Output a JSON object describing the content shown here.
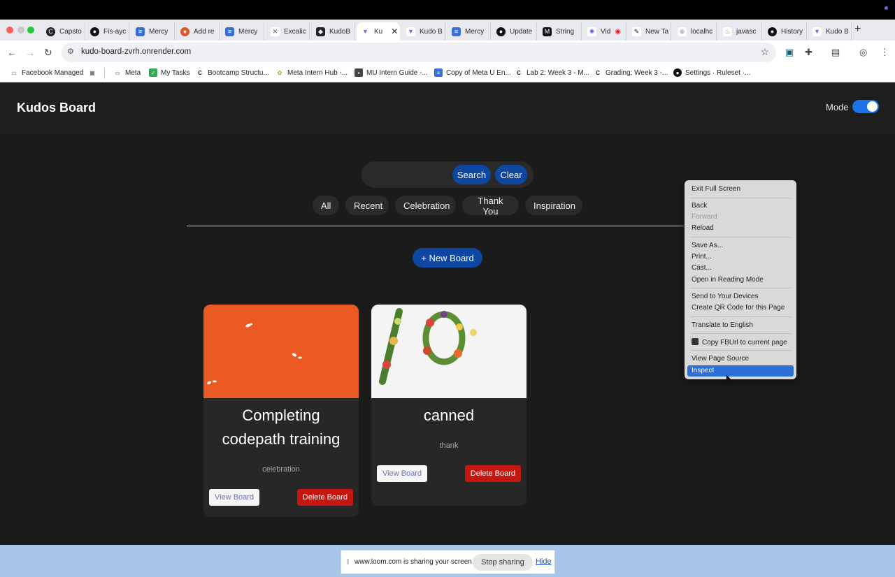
{
  "browser": {
    "tabs": [
      {
        "label": "Capsto",
        "icon": "codepath-icon"
      },
      {
        "label": "Fis-ayc",
        "icon": "github-icon"
      },
      {
        "label": "Mercy",
        "icon": "docs-icon"
      },
      {
        "label": "Add re",
        "icon": "reddit-icon"
      },
      {
        "label": "Mercy",
        "icon": "docs-icon"
      },
      {
        "label": "Excalic",
        "icon": "excalidraw-icon"
      },
      {
        "label": "KudoB",
        "icon": "app-icon"
      },
      {
        "label": "Ku",
        "icon": "vite-icon",
        "active": true
      },
      {
        "label": "Kudo B",
        "icon": "vite-icon"
      },
      {
        "label": "Mercy",
        "icon": "docs-icon"
      },
      {
        "label": "Update",
        "icon": "github-icon"
      },
      {
        "label": "String",
        "icon": "medium-icon"
      },
      {
        "label": "Vid",
        "icon": "gear-icon"
      },
      {
        "label": "New Ta",
        "icon": "figma-icon"
      },
      {
        "label": "localhc",
        "icon": "globe-icon"
      },
      {
        "label": "javasc",
        "icon": "java-icon"
      },
      {
        "label": "History",
        "icon": "github-icon"
      },
      {
        "label": "Kudo B",
        "icon": "vite-icon"
      }
    ],
    "url": "kudo-board-zvrh.onrender.com",
    "bookmarks": [
      "Facebook Managed",
      "Meta",
      "My Tasks",
      "Bootcamp Structu...",
      "Meta Intern Hub -...",
      "MU Intern Guide -...",
      "Copy of Meta U En...",
      "Lab 2: Week 3 - M...",
      "Grading: Week 3 -...",
      "Settings · Ruleset ·..."
    ]
  },
  "app": {
    "title": "Kudos Board",
    "mode_label": "Mode",
    "dark_mode_on": true,
    "search": {
      "value": "",
      "placeholder": "",
      "search_label": "Search",
      "clear_label": "Clear"
    },
    "filters": [
      "All",
      "Recent",
      "Celebration",
      "Thank You",
      "Inspiration"
    ],
    "new_board_label": "+ New Board",
    "boards": [
      {
        "title": "Completing codepath training",
        "category": "celebration",
        "view_label": "View Board",
        "delete_label": "Delete Board",
        "image": "orange-background-with-seeds"
      },
      {
        "title": "canned",
        "category": "thank",
        "view_label": "View Board",
        "delete_label": "Delete Board",
        "image": "vegetable-wreath-on-white"
      }
    ]
  },
  "context_menu": {
    "items": [
      {
        "label": "Exit Full Screen",
        "enabled": true
      },
      {
        "label": "Back",
        "enabled": true
      },
      {
        "label": "Forward",
        "enabled": false
      },
      {
        "label": "Reload",
        "enabled": true
      },
      {
        "label": "Save As...",
        "enabled": true
      },
      {
        "label": "Print...",
        "enabled": true
      },
      {
        "label": "Cast...",
        "enabled": true
      },
      {
        "label": "Open in Reading Mode",
        "enabled": true
      },
      {
        "label": "Send to Your Devices",
        "enabled": true
      },
      {
        "label": "Create QR Code for this Page",
        "enabled": true
      },
      {
        "label": "Translate to English",
        "enabled": true
      },
      {
        "label": "Copy FBUrl to current page",
        "enabled": true
      },
      {
        "label": "View Page Source",
        "enabled": true
      },
      {
        "label": "Inspect",
        "enabled": true,
        "highlighted": true
      }
    ]
  },
  "loom_bar": {
    "message": "www.loom.com is sharing your screen.",
    "stop_label": "Stop sharing",
    "hide_label": "Hide"
  },
  "colors": {
    "page_bg": "#1b1b1b",
    "primary_blue": "#0d47a1",
    "delete_red": "#c3170f",
    "card_orange": "#ec5a24",
    "menu_highlight": "#2c6fd6"
  }
}
